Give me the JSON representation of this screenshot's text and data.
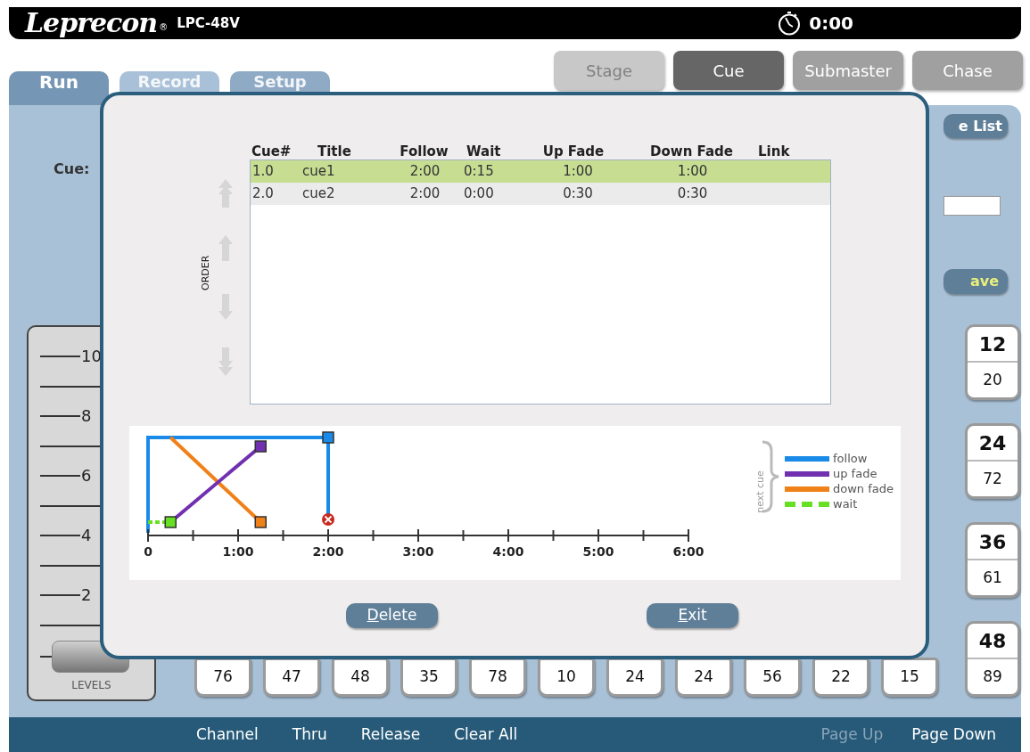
{
  "header": {
    "logo": "Leprecon",
    "registered": "®",
    "model": "LPC-48V",
    "timer": "0:00"
  },
  "tabs": [
    {
      "label": "Run",
      "selected": true,
      "disabled": false
    },
    {
      "label": "Record",
      "selected": false,
      "disabled": true
    },
    {
      "label": "Setup",
      "selected": false,
      "disabled": false
    }
  ],
  "modes": [
    {
      "label": "Stage",
      "selected": false,
      "disabled": true
    },
    {
      "label": "Cue",
      "selected": true,
      "disabled": false
    },
    {
      "label": "Submaster",
      "selected": false,
      "disabled": false
    },
    {
      "label": "Chase",
      "selected": false,
      "disabled": false
    }
  ],
  "cue_label": "Cue:",
  "list_button": "e List",
  "save_button": "ave",
  "fader": {
    "scale": [
      "10",
      "8",
      "6",
      "4",
      "2"
    ],
    "label": "LEVELS",
    "level": 0
  },
  "channels": [
    {
      "number": "12",
      "value": "20"
    },
    {
      "number": "24",
      "value": "72"
    },
    {
      "number": "36",
      "value": "61"
    },
    {
      "number": "48",
      "value": "89"
    }
  ],
  "bottom_values": [
    "76",
    "47",
    "48",
    "35",
    "78",
    "10",
    "24",
    "24",
    "56",
    "22",
    "15"
  ],
  "dialog": {
    "order_label": "ORDER",
    "order_buttons": [
      {
        "kind": "top",
        "disabled": true
      },
      {
        "kind": "up",
        "disabled": true
      },
      {
        "kind": "down",
        "disabled": true
      },
      {
        "kind": "bottom",
        "disabled": true
      }
    ],
    "columns": [
      "Cue#",
      "Title",
      "Follow",
      "Wait",
      "Up Fade",
      "Down Fade",
      "Link"
    ],
    "rows": [
      {
        "cue": "1.0",
        "title": "cue1",
        "follow": "2:00",
        "wait": "0:15",
        "up_fade": "1:00",
        "down_fade": "1:00",
        "selected": true
      },
      {
        "cue": "2.0",
        "title": "cue2",
        "follow": "2:00",
        "wait": "0:00",
        "up_fade": "0:30",
        "down_fade": "0:30",
        "selected": false
      }
    ],
    "timeline": {
      "ticks": [
        "0",
        "1:00",
        "2:00",
        "3:00",
        "4:00",
        "5:00",
        "6:00"
      ],
      "brace_label": "next cue",
      "legend": [
        {
          "label": "follow",
          "color": "#1a8ae8",
          "kind": "solid"
        },
        {
          "label": "up fade",
          "color": "#7030b0",
          "kind": "solid"
        },
        {
          "label": "down fade",
          "color": "#f08018",
          "kind": "solid"
        },
        {
          "label": "wait",
          "color": "#66e022",
          "kind": "dashed"
        }
      ]
    },
    "buttons": [
      "Delete",
      "Exit"
    ]
  },
  "bottom_bar": [
    {
      "label": "Channel",
      "disabled": false
    },
    {
      "label": "Thru",
      "disabled": false
    },
    {
      "label": "Release",
      "disabled": false
    },
    {
      "label": "Clear All",
      "disabled": false
    },
    {
      "label": "Page Up",
      "disabled": true
    },
    {
      "label": "Page Down",
      "disabled": false
    }
  ]
}
